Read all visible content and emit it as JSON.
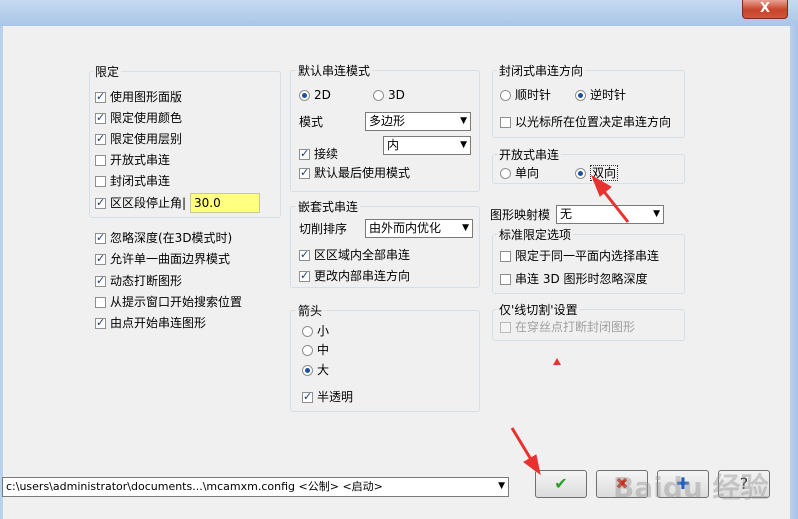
{
  "window": {
    "close_label": "X"
  },
  "limit_group": {
    "title": "限定",
    "items": [
      {
        "label": "使用图形面版",
        "checked": true
      },
      {
        "label": "限定使用颜色",
        "checked": true
      },
      {
        "label": "限定使用层别",
        "checked": true
      },
      {
        "label": "开放式串连",
        "checked": false
      },
      {
        "label": "封闭式串连",
        "checked": false
      },
      {
        "label": "区区段停止角|",
        "checked": true
      }
    ],
    "angle_value": "30.0"
  },
  "options": [
    {
      "label": "忽略深度(在3D模式时)",
      "checked": true
    },
    {
      "label": "允许单一曲面边界模式",
      "checked": true
    },
    {
      "label": "动态打断图形",
      "checked": true
    },
    {
      "label": "从提示窗口开始搜索位置",
      "checked": false
    },
    {
      "label": "由点开始串连图形",
      "checked": true
    }
  ],
  "default_mode": {
    "title": "默认串连模式",
    "radio_2d": "2D",
    "radio_3d": "3D",
    "mode_label": "模式",
    "mode_value": "多边形",
    "inner_value": "内",
    "continue_label": "接续",
    "last_mode_label": "默认最后使用模式"
  },
  "nested": {
    "title": "嵌套式串连",
    "cut_order_label": "切削排序",
    "cut_order_value": "由外而内优化",
    "all_in_region": "区区域内全部串连",
    "change_direction": "更改内部串连方向"
  },
  "arrow_group": {
    "title": "箭头",
    "small": "小",
    "medium": "中",
    "large": "大",
    "transparent": "半透明"
  },
  "closed_direction": {
    "title": "封闭式串连方向",
    "cw": "顺时针",
    "ccw": "逆时针",
    "cursor_dir": "以光标所在位置决定串连方向"
  },
  "open_chain": {
    "title": "开放式串连",
    "single": "单向",
    "double": "双向"
  },
  "mapping": {
    "label": "图形映射模",
    "value": "无"
  },
  "standard_limit": {
    "title": "标准限定选项",
    "same_plane": "限定于同一平面内选择串连",
    "ignore_depth": "串连 3D 图形时忽略深度"
  },
  "line_cut": {
    "title": "仅'线切割'设置",
    "break_closed": "在穿丝点打断封闭图形"
  },
  "config_path": "c:\\users\\administrator\\documents...\\mcamxm.config <公制> <启动>",
  "buttons": {
    "ok": "✔",
    "cancel": "✖",
    "add": "✚",
    "help": "?"
  },
  "watermark": "Baidu 经验",
  "colors": {
    "annotation_arrow": "#e8322f",
    "ok_green": "#2e9b2e",
    "cancel_red": "#d02a1a",
    "add_blue": "#1f5fc4"
  }
}
